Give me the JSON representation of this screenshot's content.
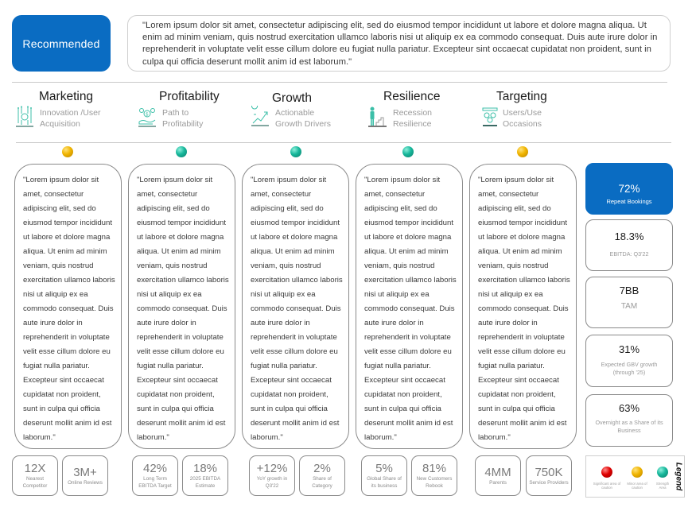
{
  "header": {
    "badge_label": "Recommended",
    "summary_quote": "\"Lorem ipsum dolor sit amet, consectetur adipiscing elit, sed do eiusmod tempor incididunt ut labore et dolore magna aliqua. Ut enim ad minim veniam, quis nostrud exercitation ullamco laboris nisi ut aliquip ex ea commodo consequat. Duis aute irure dolor in reprehenderit in voluptate velit esse cillum dolore eu fugiat nulla pariatur. Excepteur sint occaecat cupidatat non proident, sunt in culpa qui officia deserunt mollit anim id est laborum.\""
  },
  "categories": [
    {
      "title": "Marketing",
      "subtitle_1": "Innovation /User",
      "subtitle_2": "Acquisition",
      "icon": "innovation-icon",
      "status": "yellow",
      "text": "\"Lorem ipsum dolor sit amet, consectetur adipiscing elit, sed do eiusmod tempor incididunt ut labore et dolore magna aliqua. Ut enim ad minim veniam, quis nostrud exercitation ullamco laboris nisi ut aliquip ex ea commodo consequat. Duis aute irure dolor in reprehenderit in voluptate velit esse cillum dolore eu fugiat nulla pariatur. Excepteur sint occaecat cupidatat non proident, sunt in culpa qui officia deserunt mollit anim id est laborum.\"",
      "kpis": [
        {
          "value": "12X",
          "label": "Nearest Competitor"
        },
        {
          "value": "3M+",
          "label": "Online Reviews"
        }
      ]
    },
    {
      "title": "Profitability",
      "subtitle_1": "Path to",
      "subtitle_2": "Profitability",
      "icon": "money-hand-icon",
      "status": "teal",
      "text": "\"Lorem ipsum dolor sit amet, consectetur adipiscing elit, sed do eiusmod tempor incididunt ut labore et dolore magna aliqua. Ut enim ad minim veniam, quis nostrud exercitation ullamco laboris nisi ut aliquip ex ea commodo consequat. Duis aute irure dolor in reprehenderit in voluptate velit esse cillum dolore eu fugiat nulla pariatur. Excepteur sint occaecat cupidatat non proident, sunt in culpa qui officia deserunt mollit anim id est laborum.\"",
      "kpis": [
        {
          "value": "42%",
          "label": "Long Term EBITDA Target"
        },
        {
          "value": "18%",
          "label": "2025 EBITDA Estimate"
        }
      ]
    },
    {
      "title": "Growth",
      "subtitle_1": "Actionable",
      "subtitle_2": "Growth Drivers",
      "icon": "growth-idea-icon",
      "status": "teal",
      "text": "\"Lorem ipsum dolor sit amet, consectetur adipiscing elit, sed do eiusmod tempor incididunt ut labore et dolore magna aliqua. Ut enim ad minim veniam, quis nostrud exercitation ullamco laboris nisi ut aliquip ex ea commodo consequat. Duis aute irure dolor in reprehenderit in voluptate velit esse cillum dolore eu fugiat nulla pariatur. Excepteur sint occaecat cupidatat non proident, sunt in culpa qui officia deserunt mollit anim id est laborum.\"",
      "kpis": [
        {
          "value": "+12%",
          "label": "YoY growth in Q3'22"
        },
        {
          "value": "2%",
          "label": "Share of Category"
        }
      ]
    },
    {
      "title": "Resilience",
      "subtitle_1": "Recession",
      "subtitle_2": "Resilience",
      "icon": "person-stairs-icon",
      "status": "teal",
      "text": "\"Lorem ipsum dolor sit amet, consectetur adipiscing elit, sed do eiusmod tempor incididunt ut labore et dolore magna aliqua. Ut enim ad minim veniam, quis nostrud exercitation ullamco laboris nisi ut aliquip ex ea commodo consequat. Duis aute irure dolor in reprehenderit in voluptate velit esse cillum dolore eu fugiat nulla pariatur. Excepteur sint occaecat cupidatat non proident, sunt in culpa qui officia deserunt mollit anim id est laborum.\"",
      "kpis": [
        {
          "value": "5%",
          "label": "Global Share of its business"
        },
        {
          "value": "81%",
          "label": "New Customers Rebook"
        }
      ]
    },
    {
      "title": "Targeting",
      "subtitle_1": "Users/Use",
      "subtitle_2": "Occasions",
      "icon": "target-audience-icon",
      "status": "yellow",
      "text": "\"Lorem ipsum dolor sit amet, consectetur adipiscing elit, sed do eiusmod tempor incididunt ut labore et dolore magna aliqua. Ut enim ad minim veniam, quis nostrud exercitation ullamco laboris nisi ut aliquip ex ea commodo consequat. Duis aute irure dolor in reprehenderit in voluptate velit esse cillum dolore eu fugiat nulla pariatur. Excepteur sint occaecat cupidatat non proident, sunt in culpa qui officia deserunt mollit anim id est laborum.\"",
      "kpis": [
        {
          "value": "4MM",
          "label": "Parents"
        },
        {
          "value": "750K",
          "label": "Service Providers"
        }
      ]
    }
  ],
  "side_kpis": [
    {
      "value": "72%",
      "label": "Repeat Bookings",
      "highlight": true
    },
    {
      "value": "18.3%",
      "label": "EBITDA: Q3'22"
    },
    {
      "value": "7BB",
      "label": "TAM"
    },
    {
      "value": "31%",
      "label": "Expected GBV growth (through '25)"
    },
    {
      "value": "63%",
      "label": "Overnight as a Share of its Business"
    }
  ],
  "legend": {
    "title": "Legend",
    "items": [
      {
        "color": "red",
        "label": "Significant area of caution"
      },
      {
        "color": "yellow",
        "label": "Minor area of caution"
      },
      {
        "color": "teal",
        "label": "Strength Area"
      }
    ]
  },
  "colors": {
    "accent_blue": "#0a6cc2",
    "yellow": "#f0b400",
    "teal": "#17b79b",
    "red": "#e00000",
    "icon_teal": "#3cbfa8"
  }
}
